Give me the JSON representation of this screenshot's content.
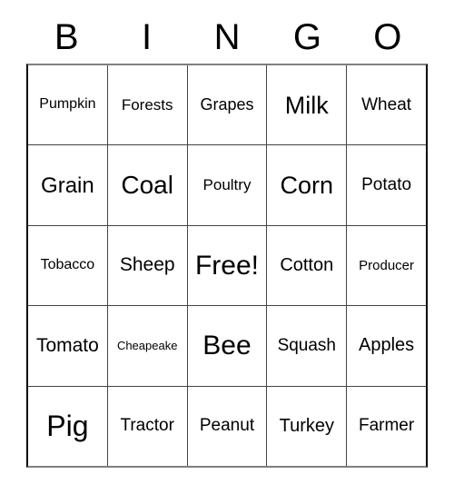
{
  "card": {
    "title": "BINGO",
    "background_color": "#ffffff",
    "text_color": "#000000",
    "border_color_dark": "#000000",
    "border_color_light": "#808080",
    "grid_line_color": "#444444"
  },
  "header": {
    "letters": [
      "B",
      "I",
      "N",
      "G",
      "O"
    ]
  },
  "grid": {
    "columns": 5,
    "rows": 5,
    "free_space": {
      "row": 2,
      "column": 2,
      "label": "Free!"
    },
    "cells": [
      [
        {
          "label": "Pumpkin",
          "font_size": "16px"
        },
        {
          "label": "Forests",
          "font_size": "17px"
        },
        {
          "label": "Grapes",
          "font_size": "18px"
        },
        {
          "label": "Milk",
          "font_size": "27px"
        },
        {
          "label": "Wheat",
          "font_size": "19px"
        }
      ],
      [
        {
          "label": "Grain",
          "font_size": "24px"
        },
        {
          "label": "Coal",
          "font_size": "28px"
        },
        {
          "label": "Poultry",
          "font_size": "17px"
        },
        {
          "label": "Corn",
          "font_size": "27px"
        },
        {
          "label": "Potato",
          "font_size": "19px"
        }
      ],
      [
        {
          "label": "Tobacco",
          "font_size": "16px"
        },
        {
          "label": "Sheep",
          "font_size": "21px"
        },
        {
          "label": "Free!",
          "font_size": "30px"
        },
        {
          "label": "Cotton",
          "font_size": "20px"
        },
        {
          "label": "Producer",
          "font_size": "15px"
        }
      ],
      [
        {
          "label": "Tomato",
          "font_size": "21px"
        },
        {
          "label": "Cheapeake",
          "font_size": "13px"
        },
        {
          "label": "Bee",
          "font_size": "30px"
        },
        {
          "label": "Squash",
          "font_size": "19px"
        },
        {
          "label": "Apples",
          "font_size": "20px"
        }
      ],
      [
        {
          "label": "Pig",
          "font_size": "32px"
        },
        {
          "label": "Tractor",
          "font_size": "19px"
        },
        {
          "label": "Peanut",
          "font_size": "19px"
        },
        {
          "label": "Turkey",
          "font_size": "20px"
        },
        {
          "label": "Farmer",
          "font_size": "19px"
        }
      ]
    ]
  }
}
